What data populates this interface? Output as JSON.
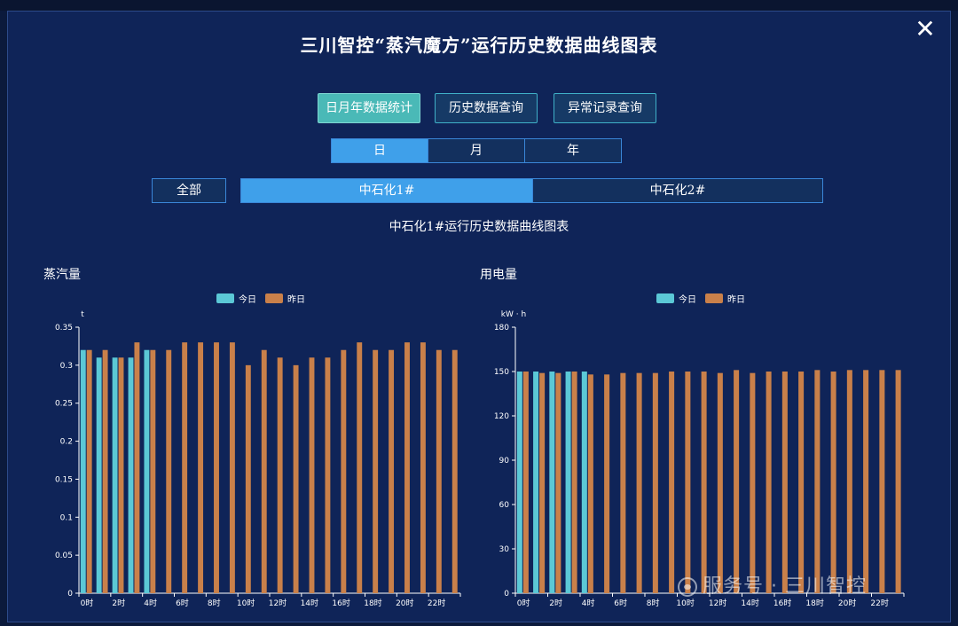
{
  "modal": {
    "title": "三川智控“蒸汽魔方”运行历史数据曲线图表",
    "close_label": "✕"
  },
  "modes": [
    {
      "label": "日月年数据统计",
      "active": true
    },
    {
      "label": "历史数据查询",
      "active": false
    },
    {
      "label": "异常记录查询",
      "active": false
    }
  ],
  "period_tabs": [
    {
      "label": "日",
      "active": true
    },
    {
      "label": "月",
      "active": false
    },
    {
      "label": "年",
      "active": false
    }
  ],
  "stations": {
    "all_label": "全部",
    "items": [
      {
        "label": "中石化1#",
        "active": true
      },
      {
        "label": "中石化2#",
        "active": false
      }
    ]
  },
  "subtitle": "中石化1#运行历史数据曲线图表",
  "watermark": "服务号 · 三川智控",
  "colors": {
    "today": "#5bc8d6",
    "yesterday": "#c9804a",
    "axis": "#ffffff",
    "accent": "#3fa0ea"
  },
  "chart_data": [
    {
      "type": "bar",
      "title": "蒸汽量",
      "ylabel": "t",
      "ylim": [
        0,
        0.35
      ],
      "yticks": [
        0,
        0.05,
        0.1,
        0.15,
        0.2,
        0.25,
        0.3,
        0.35
      ],
      "tick_labels": [
        "0时",
        "2时",
        "4时",
        "6时",
        "8时",
        "10时",
        "12时",
        "14时",
        "16时",
        "18时",
        "20时",
        "22时"
      ],
      "categories": [
        "0",
        "1",
        "2",
        "3",
        "4",
        "5",
        "6",
        "7",
        "8",
        "9",
        "10",
        "11",
        "12",
        "13",
        "14",
        "15",
        "16",
        "17",
        "18",
        "19",
        "20",
        "21",
        "22",
        "23"
      ],
      "series": [
        {
          "name": "今日",
          "values": [
            0.32,
            0.31,
            0.31,
            0.31,
            0.32,
            null,
            null,
            null,
            null,
            null,
            null,
            null,
            null,
            null,
            null,
            null,
            null,
            null,
            null,
            null,
            null,
            null,
            null,
            null
          ]
        },
        {
          "name": "昨日",
          "values": [
            0.32,
            0.32,
            0.31,
            0.33,
            0.32,
            0.32,
            0.33,
            0.33,
            0.33,
            0.33,
            0.3,
            0.32,
            0.31,
            0.3,
            0.31,
            0.31,
            0.32,
            0.33,
            0.32,
            0.32,
            0.33,
            0.33,
            0.32,
            0.32
          ]
        }
      ],
      "legend": "top-center",
      "grid": false
    },
    {
      "type": "bar",
      "title": "用电量",
      "ylabel": "kW · h",
      "ylim": [
        0,
        180
      ],
      "yticks": [
        0,
        30,
        60,
        90,
        120,
        150,
        180
      ],
      "tick_labels": [
        "0时",
        "2时",
        "4时",
        "6时",
        "8时",
        "10时",
        "12时",
        "14时",
        "16时",
        "18时",
        "20时",
        "22时"
      ],
      "categories": [
        "0",
        "1",
        "2",
        "3",
        "4",
        "5",
        "6",
        "7",
        "8",
        "9",
        "10",
        "11",
        "12",
        "13",
        "14",
        "15",
        "16",
        "17",
        "18",
        "19",
        "20",
        "21",
        "22",
        "23"
      ],
      "series": [
        {
          "name": "今日",
          "values": [
            150,
            150,
            150,
            150,
            150,
            null,
            null,
            null,
            null,
            null,
            null,
            null,
            null,
            null,
            null,
            null,
            null,
            null,
            null,
            null,
            null,
            null,
            null,
            null
          ]
        },
        {
          "name": "昨日",
          "values": [
            150,
            149,
            149,
            150,
            148,
            148,
            149,
            149,
            149,
            150,
            150,
            150,
            149,
            151,
            149,
            150,
            150,
            150,
            151,
            150,
            151,
            151,
            151,
            151
          ]
        }
      ],
      "legend": "top-center",
      "grid": false
    }
  ]
}
